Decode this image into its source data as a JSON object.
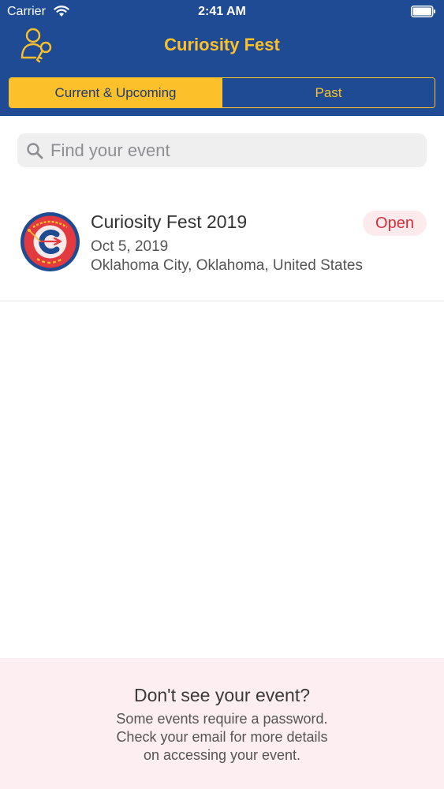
{
  "status_bar": {
    "carrier": "Carrier",
    "time": "2:41 AM"
  },
  "header": {
    "title": "Curiosity Fest",
    "tabs": [
      {
        "label": "Current & Upcoming",
        "active": true
      },
      {
        "label": "Past",
        "active": false
      }
    ]
  },
  "search": {
    "placeholder": "Find your event",
    "value": ""
  },
  "events": [
    {
      "name": "Curiosity Fest 2019",
      "date": "Oct 5, 2019",
      "location": "Oklahoma City, Oklahoma, United States",
      "status": "Open",
      "logo_icon": "curiosity-fest-logo"
    }
  ],
  "footer": {
    "heading": "Don't see your event?",
    "lines": [
      "Some events require a password.",
      "Check your email for more details",
      "on accessing your event."
    ]
  },
  "colors": {
    "header_bg": "#1e4b93",
    "accent_yellow": "#fcc02b",
    "open_red": "#d62f3a",
    "footer_bg": "#fdeef1"
  }
}
